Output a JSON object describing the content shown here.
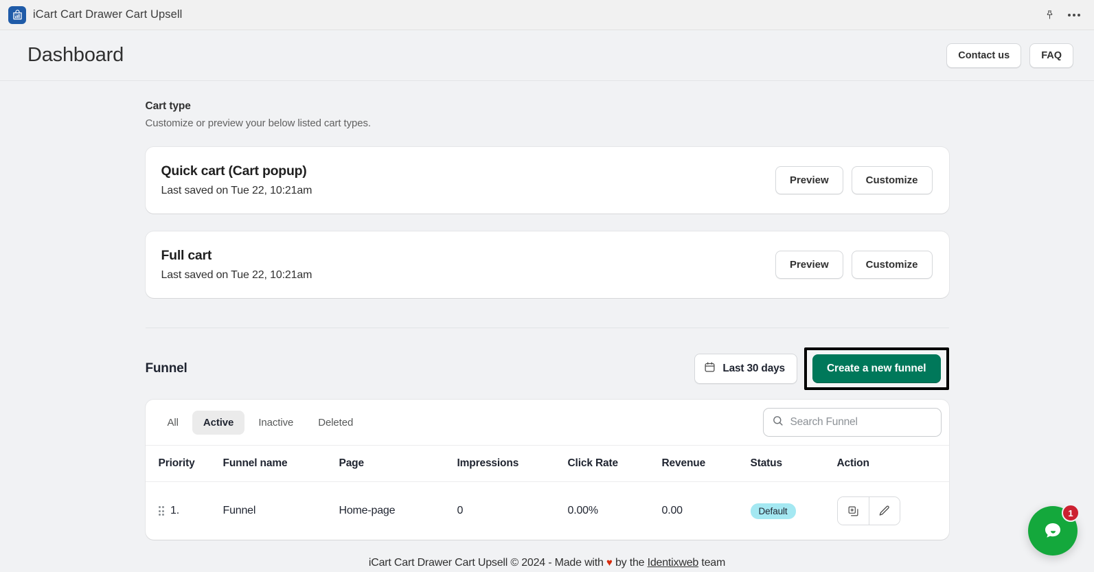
{
  "topbar": {
    "app_title": "iCart Cart Drawer Cart Upsell",
    "app_icon": "shopping-bag-chart-icon",
    "pin_icon": "pin-icon",
    "more_icon": "more-options-icon"
  },
  "header": {
    "title": "Dashboard",
    "contact_label": "Contact us",
    "faq_label": "FAQ"
  },
  "cart_type": {
    "title": "Cart type",
    "subtitle": "Customize or preview your below listed cart types.",
    "cards": [
      {
        "title": "Quick cart (Cart popup)",
        "meta": "Last saved on Tue 22, 10:21am",
        "preview_label": "Preview",
        "customize_label": "Customize"
      },
      {
        "title": "Full cart",
        "meta": "Last saved on Tue 22, 10:21am",
        "preview_label": "Preview",
        "customize_label": "Customize"
      }
    ]
  },
  "funnel": {
    "title": "Funnel",
    "date_range_label": "Last 30 days",
    "date_icon": "calendar-icon",
    "create_label": "Create a new funnel",
    "create_accent": "#00785a",
    "tabs": [
      {
        "label": "All",
        "active": false
      },
      {
        "label": "Active",
        "active": true
      },
      {
        "label": "Inactive",
        "active": false
      },
      {
        "label": "Deleted",
        "active": false
      }
    ],
    "search": {
      "placeholder": "Search Funnel",
      "value": "",
      "icon": "search-icon"
    },
    "columns": [
      "Priority",
      "Funnel name",
      "Page",
      "Impressions",
      "Click Rate",
      "Revenue",
      "Status",
      "Action"
    ],
    "rows": [
      {
        "priority": "1.",
        "name": "Funnel",
        "page": "Home-page",
        "impressions": "0",
        "click_rate": "0.00%",
        "revenue": "0.00",
        "status": "Default",
        "status_color": "#a4e8f2",
        "actions": [
          "duplicate-icon",
          "edit-icon"
        ]
      }
    ]
  },
  "footer": {
    "prefix": "iCart Cart Drawer Cart Upsell © 2024 - Made with ",
    "heart": "♥",
    "middle": " by the ",
    "link": "Identixweb",
    "suffix": " team"
  },
  "chat": {
    "badge_count": "1",
    "icon": "chat-bubble-icon",
    "color": "#14a83c"
  }
}
